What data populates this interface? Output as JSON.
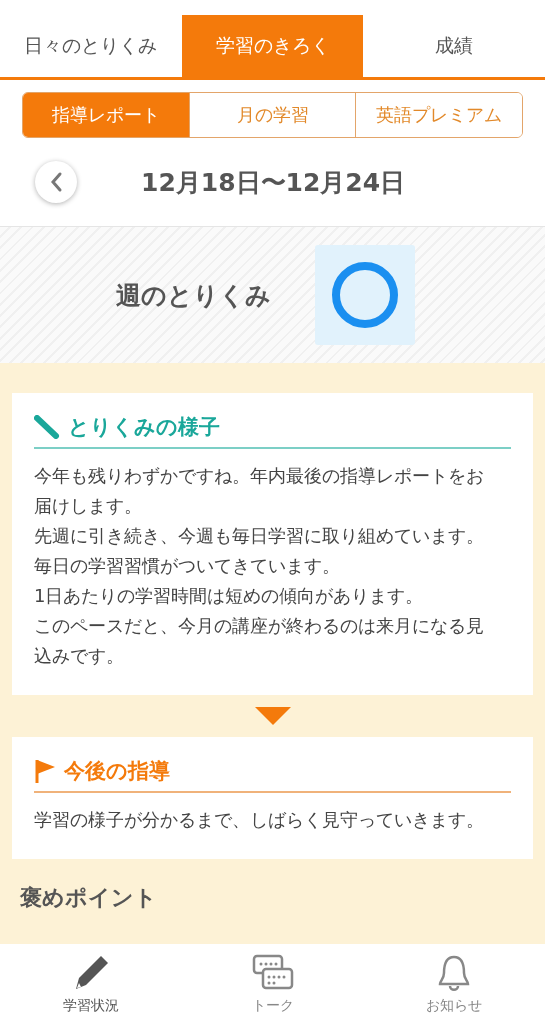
{
  "tabs": [
    {
      "label": "日々のとりくみ",
      "selected": false
    },
    {
      "label": "学習のきろく",
      "selected": true
    },
    {
      "label": "成績",
      "selected": false
    }
  ],
  "subtabs": [
    {
      "label": "指導レポート",
      "selected": true
    },
    {
      "label": "月の学習",
      "selected": false
    },
    {
      "label": "英語プレミアム",
      "selected": false
    }
  ],
  "week": {
    "range": "12月18日〜12月24日"
  },
  "weekly_effort": {
    "label": "週のとりくみ",
    "kind": "circle"
  },
  "sections": [
    {
      "kind": "pen",
      "title": "とりくみの様子",
      "paragraphs": [
        "今年も残りわずかですね。年内最後の指導レポートをお届けします。",
        "先週に引き続き、今週も毎日学習に取り組めています。毎日の学習習慣がついてきています。",
        "1日あたりの学習時間は短めの傾向があります。",
        "このペースだと、今月の講座が終わるのは来月になる見込みです。"
      ]
    },
    {
      "kind": "flag",
      "title": "今後の指導",
      "paragraphs": [
        "学習の様子が分かるまで、しばらく見守っていきます。"
      ]
    }
  ],
  "praise_heading": "褒めポイント",
  "bottom_nav": [
    {
      "kind": "pencil",
      "label": "学習状況",
      "selected": true
    },
    {
      "kind": "chat",
      "label": "トーク",
      "selected": false
    },
    {
      "kind": "bell",
      "label": "お知らせ",
      "selected": false
    }
  ]
}
